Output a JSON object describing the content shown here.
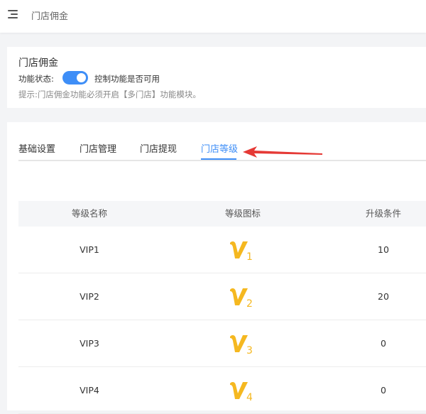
{
  "header": {
    "title": "门店佣金"
  },
  "settings": {
    "heading": "门店佣金",
    "status_label": "功能状态:",
    "toggle_on": true,
    "status_desc": "控制功能是否可用",
    "hint": "提示:门店佣金功能必须开启【多门店】功能模块。"
  },
  "tabs": [
    {
      "label": "基础设置",
      "active": false
    },
    {
      "label": "门店管理",
      "active": false
    },
    {
      "label": "门店提现",
      "active": false
    },
    {
      "label": "门店等级",
      "active": true
    }
  ],
  "table": {
    "headers": [
      "等级名称",
      "等级图标",
      "升级条件"
    ],
    "rows": [
      {
        "name": "VIP1",
        "level": "1",
        "condition": "10"
      },
      {
        "name": "VIP2",
        "level": "2",
        "condition": "20"
      },
      {
        "name": "VIP3",
        "level": "3",
        "condition": "0"
      },
      {
        "name": "VIP4",
        "level": "4",
        "condition": "0"
      }
    ]
  },
  "colors": {
    "accent": "#3e8ef7",
    "vip_gold": "#f5b820",
    "arrow_red": "#e53935"
  }
}
